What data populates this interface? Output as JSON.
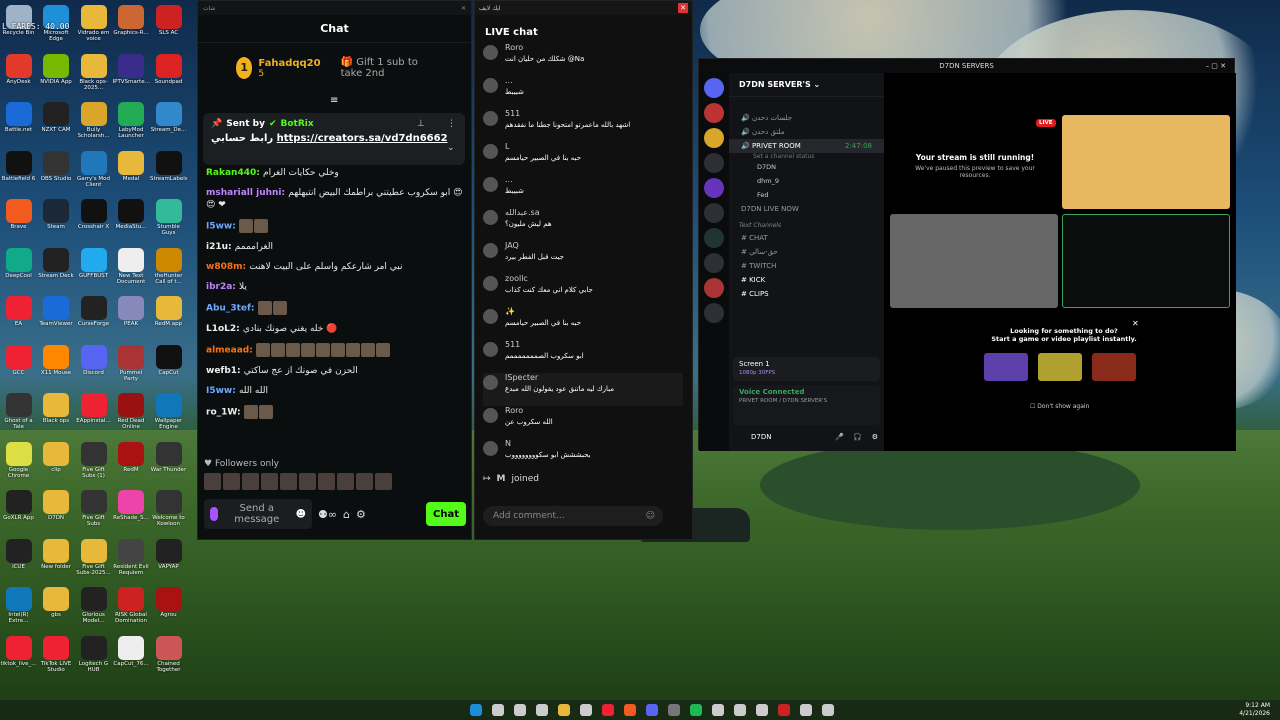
{
  "desktop": {
    "overlay_text": "L FARES: 40.00",
    "icons": [
      {
        "label": "Recycle Bin",
        "color": "#9fb2c8"
      },
      {
        "label": "Microsoft Edge",
        "color": "#1e8fd8"
      },
      {
        "label": "Vidrado em voice",
        "color": "#e8b83a"
      },
      {
        "label": "Graphics-R...",
        "color": "#c63"
      },
      {
        "label": "SLS AC",
        "color": "#c22"
      },
      {
        "label": "AnyDesk",
        "color": "#e23a2a"
      },
      {
        "label": "NVIDIA App",
        "color": "#76b900"
      },
      {
        "label": "Black ops-2025...",
        "color": "#e8b83a"
      },
      {
        "label": "IPTVSmarte...",
        "color": "#3a2c8a"
      },
      {
        "label": "Soundpad",
        "color": "#d22"
      },
      {
        "label": "Battle.net",
        "color": "#1a6ad8"
      },
      {
        "label": "NZXT CAM",
        "color": "#222"
      },
      {
        "label": "Bully Scholarsh...",
        "color": "#d9a52a"
      },
      {
        "label": "LabyMod Launcher",
        "color": "#2a5"
      },
      {
        "label": "Stream_De...",
        "color": "#38c"
      },
      {
        "label": "Battlefield 6",
        "color": "#111"
      },
      {
        "label": "OBS Studio",
        "color": "#333"
      },
      {
        "label": "Garry's Mod Client",
        "color": "#27b"
      },
      {
        "label": "Medal",
        "color": "#e8b83a"
      },
      {
        "label": "StreamLabels",
        "color": "#111"
      },
      {
        "label": "Brave",
        "color": "#f25a1e"
      },
      {
        "label": "Steam",
        "color": "#1b2838"
      },
      {
        "label": "Crosshair X",
        "color": "#111"
      },
      {
        "label": "MediaStu...",
        "color": "#111"
      },
      {
        "label": "Stumble Guys",
        "color": "#3b9"
      },
      {
        "label": "DeepCool",
        "color": "#1a8"
      },
      {
        "label": "Stream Deck",
        "color": "#222"
      },
      {
        "label": "GUFFBUST",
        "color": "#2ae"
      },
      {
        "label": "New Text Document",
        "color": "#eee"
      },
      {
        "label": "theHunter Call of t...",
        "color": "#c80"
      },
      {
        "label": "EA",
        "color": "#e23"
      },
      {
        "label": "TeamViewer",
        "color": "#1a6ad8"
      },
      {
        "label": "CurseForge",
        "color": "#222"
      },
      {
        "label": "PEAK",
        "color": "#88b"
      },
      {
        "label": "RedM.app",
        "color": "#e8b83a"
      },
      {
        "label": "GCC",
        "color": "#e23"
      },
      {
        "label": "X11 Mouse",
        "color": "#f80"
      },
      {
        "label": "Discord",
        "color": "#5865f2"
      },
      {
        "label": "Pummel Party",
        "color": "#a33"
      },
      {
        "label": "CapCut",
        "color": "#111"
      },
      {
        "label": "Ghost of a Tale",
        "color": "#333"
      },
      {
        "label": "Black ops",
        "color": "#e8b83a"
      },
      {
        "label": "EAppinstal...",
        "color": "#e23"
      },
      {
        "label": "Red Dead Online",
        "color": "#911"
      },
      {
        "label": "Wallpaper Engine",
        "color": "#17b"
      },
      {
        "label": "Google Chrome",
        "color": "#dd4"
      },
      {
        "label": "clip",
        "color": "#e8b83a"
      },
      {
        "label": "Five Gift Subs (1)",
        "color": "#333"
      },
      {
        "label": "RedM",
        "color": "#a11"
      },
      {
        "label": "War Thunder",
        "color": "#333"
      },
      {
        "label": "GoXLR App",
        "color": "#222"
      },
      {
        "label": "D7DN",
        "color": "#e8b83a"
      },
      {
        "label": "Five Gift Subs",
        "color": "#333"
      },
      {
        "label": "ReShade_S...",
        "color": "#e4a"
      },
      {
        "label": "Welcome to Kowloon",
        "color": "#333"
      },
      {
        "label": "iCUE",
        "color": "#222"
      },
      {
        "label": "New folder",
        "color": "#e8b83a"
      },
      {
        "label": "Five Gift Subs-2025...",
        "color": "#e8b83a"
      },
      {
        "label": "Resident Evil Requiem",
        "color": "#444"
      },
      {
        "label": "VAPYAP",
        "color": "#222"
      },
      {
        "label": "Intel(R) Extre...",
        "color": "#17b"
      },
      {
        "label": "gbs",
        "color": "#e8b83a"
      },
      {
        "label": "Glorious Model...",
        "color": "#222"
      },
      {
        "label": "RISK Global Domination",
        "color": "#c22"
      },
      {
        "label": "Agrou",
        "color": "#a11"
      },
      {
        "label": "tiktok_live_...",
        "color": "#e23"
      },
      {
        "label": "TikTok LIVE Studio",
        "color": "#e23"
      },
      {
        "label": "Logitech G HUB",
        "color": "#222"
      },
      {
        "label": "CapCut_76...",
        "color": "#eee"
      },
      {
        "label": "Chained Together",
        "color": "#c55"
      }
    ]
  },
  "kick_chat": {
    "window_title": "شات",
    "header": "Chat",
    "top_gifter": {
      "rank": "1",
      "name": "Fahadqq20",
      "count": "5",
      "cta": "Gift 1 sub to take 2nd"
    },
    "pinned": {
      "sent_by": "Sent by",
      "bot_name": "BotRix",
      "link_prefix": "رابط حسابي",
      "link": "https://creators.sa/vd7dn6662"
    },
    "messages": [
      {
        "user": "Rakan440:",
        "color": "#53fc18",
        "text": "وخلي حكايات الغرام"
      },
      {
        "user": "mshariall juhni:",
        "color": "#c084fc",
        "text": "ابو سكروب عطيتني براطمك البيض انتبهلهم 😍😍 ❤"
      },
      {
        "user": "I5ww:",
        "color": "#6fa8ff",
        "text": ""
      },
      {
        "user": "i21u:",
        "color": "#eee",
        "text": "الغرامممم"
      },
      {
        "user": "w808m:",
        "color": "#f97316",
        "text": "نبي امر شارعكم واسلم على البيت لاهنت"
      },
      {
        "user": "ibr2a:",
        "color": "#c084fc",
        "text": "يلا"
      },
      {
        "user": "Abu_3tef:",
        "color": "#6fa8ff",
        "text": ""
      },
      {
        "user": "L1oL2:",
        "color": "#eee",
        "text": "خله يغني صونك بنادي 🔴"
      },
      {
        "user": "almeaad:",
        "color": "#f97316",
        "text": ""
      },
      {
        "user": "wefb1:",
        "color": "#eee",
        "text": "الحزن في صونك از عج ساكتي"
      },
      {
        "user": "I5ww:",
        "color": "#6fa8ff",
        "text": "الله الله"
      },
      {
        "user": "ro_1W:",
        "color": "#eee",
        "text": ""
      }
    ],
    "followers_only": "Followers only",
    "send_placeholder": "Send a message",
    "chat_button": "Chat"
  },
  "live_chat": {
    "window_title": "ايك لايف",
    "header": "LIVE chat",
    "comments": [
      {
        "name": "Roro",
        "text": "شكلك من حليان انت @Na"
      },
      {
        "name": "...",
        "text": "شبيبط"
      },
      {
        "name": "511",
        "text": "اشهد بالله ماعمرتو امتحونا جطنا ما نفقدهم"
      },
      {
        "name": "L",
        "text": "حبه بنا في الصبير حيامسم"
      },
      {
        "name": "...",
        "text": "شبيبط"
      },
      {
        "name": "عبدالله.sa",
        "text": "هم ليش مليون؟"
      },
      {
        "name": "JAQ",
        "text": "جيت قبل الفطر بيرد"
      },
      {
        "name": "zoollc",
        "text": "جابي كلام اني معك كنت كذاب"
      },
      {
        "name": "✨",
        "text": "حبه بنا في الصبير حيامسم"
      },
      {
        "name": "511",
        "text": "ابو سكروب الصمممممممم"
      },
      {
        "name": "ISpecter",
        "text": "مبارك ليه ماتنق عود يقولون الله مبدع"
      },
      {
        "name": "Roro",
        "text": "الله سكروب عن"
      },
      {
        "name": "N",
        "text": "بحبششش ابو سكووووووووب"
      }
    ],
    "joined_user": "M",
    "joined_text": "joined",
    "comment_placeholder": "Add comment..."
  },
  "discord": {
    "window_title": "D7DN SERVERS",
    "server_name": "D7DN SERVER'S",
    "active_channel": "PRIVET ROOM",
    "active_channel_status": "Set a channel status",
    "channel_time": "2:47:08",
    "voice_users": [
      "D7DN",
      "dhm_9",
      "Fed"
    ],
    "live_now": "D7DN LIVE NOW",
    "text_category": "Text Channels",
    "channels": [
      "CHAT",
      "حق-سالي",
      "TWITCH",
      "KICK",
      "CLIPS"
    ],
    "screen_label": "Screen 1",
    "screen_quality": "1080p 30FPS",
    "voice_connected": "Voice Connected",
    "voice_location": "PRIVET ROOM / D7DN SERVER'S",
    "user_name": "D7DN",
    "paused_title": "Your stream is still running!",
    "paused_sub": "We've paused this preview to save your resources.",
    "live_badge": "LIVE",
    "suggest_title": "Looking for something to do?",
    "suggest_sub": "Start a game or video playlist instantly.",
    "dont_show": "Don't show again"
  },
  "taskbar": {
    "time": "9:12 AM",
    "date": "4/21/2026"
  }
}
